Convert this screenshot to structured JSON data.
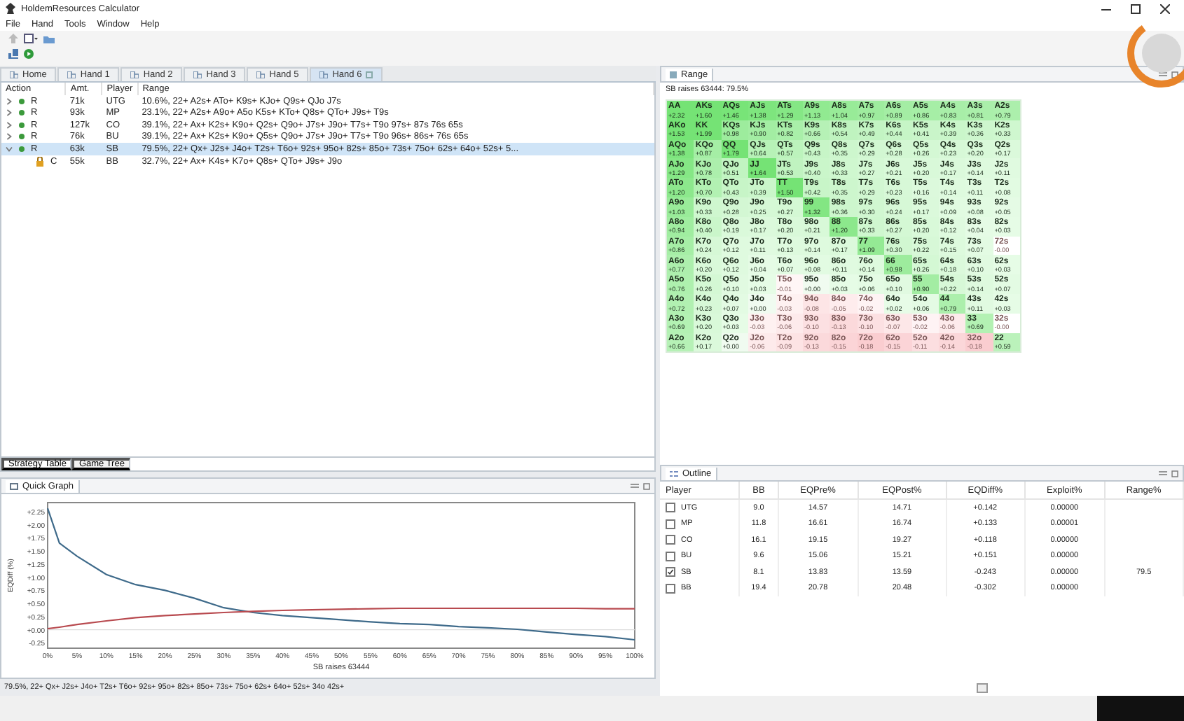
{
  "window": {
    "title": "HoldemResources Calculator"
  },
  "menu": [
    "File",
    "Hand",
    "Tools",
    "Window",
    "Help"
  ],
  "hand_tabs": [
    {
      "label": "Home",
      "selected": false
    },
    {
      "label": "Hand 1",
      "selected": false
    },
    {
      "label": "Hand 2",
      "selected": false
    },
    {
      "label": "Hand 3",
      "selected": false
    },
    {
      "label": "Hand 5",
      "selected": false
    },
    {
      "label": "Hand 6",
      "selected": true
    }
  ],
  "action_table": {
    "columns": [
      "Action",
      "Amt.",
      "Player",
      "Range"
    ],
    "rows": [
      {
        "kind": "dot",
        "expanded": false,
        "selected": false,
        "action": "R",
        "amt": "71k",
        "player": "UTG",
        "range": "10.6%, 22+ A2s+ ATo+ K9s+ KJo+ Q9s+ QJo J7s"
      },
      {
        "kind": "dot",
        "expanded": false,
        "selected": false,
        "action": "R",
        "amt": "93k",
        "player": "MP",
        "range": "23.1%, 22+ A2s+ A9o+ A5o K5s+ KTo+ Q8s+ QTo+ J9s+ T9s"
      },
      {
        "kind": "dot",
        "expanded": false,
        "selected": false,
        "action": "R",
        "amt": "127k",
        "player": "CO",
        "range": "39.1%, 22+ Ax+ K2s+ K9o+ Q2s+ Q9o+ J7s+ J9o+ T7s+ T9o 97s+ 87s 76s 65s"
      },
      {
        "kind": "dot",
        "expanded": false,
        "selected": false,
        "action": "R",
        "amt": "76k",
        "player": "BU",
        "range": "39.1%, 22+ Ax+ K2s+ K9o+ Q5s+ Q9o+ J7s+ J9o+ T7s+ T9o 96s+ 86s+ 76s 65s"
      },
      {
        "kind": "dot",
        "expanded": true,
        "selected": true,
        "action": "R",
        "amt": "63k",
        "player": "SB",
        "range": "79.5%, 22+ Qx+ J2s+ J4o+ T2s+ T6o+ 92s+ 95o+ 82s+ 85o+ 73s+ 75o+ 62s+ 64o+ 52s+ 5...",
        "children": [
          {
            "kind": "lock",
            "selected": false,
            "action": "C",
            "amt": "55k",
            "player": "BB",
            "range": "32.7%, 22+ Ax+ K4s+ K7o+ Q8s+ QTo+ J9s+ J9o"
          }
        ]
      }
    ]
  },
  "bottom_tabs": [
    {
      "label": "Strategy Table",
      "selected": true
    },
    {
      "label": "Game Tree",
      "selected": false
    }
  ],
  "quick_graph": {
    "title": "Quick Graph",
    "chart_data": {
      "type": "line",
      "xlabel": "SB raises 63444",
      "ylabel": "EQDiff (%)",
      "x": [
        0,
        2,
        5,
        10,
        15,
        20,
        25,
        30,
        35,
        40,
        45,
        50,
        55,
        60,
        65,
        70,
        75,
        80,
        85,
        90,
        95,
        100
      ],
      "series": [
        {
          "color": "#3e6a8a",
          "values": [
            2.31,
            1.65,
            1.4,
            1.05,
            0.86,
            0.75,
            0.6,
            0.42,
            0.33,
            0.27,
            0.23,
            0.19,
            0.15,
            0.12,
            0.1,
            0.06,
            0.04,
            0.01,
            -0.04,
            -0.09,
            -0.13,
            -0.19
          ]
        },
        {
          "color": "#b84a4f",
          "values": [
            0.02,
            0.05,
            0.1,
            0.17,
            0.23,
            0.27,
            0.3,
            0.33,
            0.35,
            0.37,
            0.38,
            0.39,
            0.4,
            0.41,
            0.41,
            0.41,
            0.41,
            0.41,
            0.41,
            0.41,
            0.4,
            0.4
          ]
        }
      ],
      "xlim": [
        0,
        100
      ],
      "ylim": [
        -0.35,
        2.42
      ],
      "xticks": [
        {
          "value": 0,
          "label": "0%"
        },
        {
          "value": 5,
          "label": "5%"
        },
        {
          "value": 10,
          "label": "10%"
        },
        {
          "value": 15,
          "label": "15%"
        },
        {
          "value": 20,
          "label": "20%"
        },
        {
          "value": 25,
          "label": "25%"
        },
        {
          "value": 30,
          "label": "30%"
        },
        {
          "value": 35,
          "label": "35%"
        },
        {
          "value": 40,
          "label": "40%"
        },
        {
          "value": 45,
          "label": "45%"
        },
        {
          "value": 50,
          "label": "50%"
        },
        {
          "value": 55,
          "label": "55%"
        },
        {
          "value": 60,
          "label": "60%"
        },
        {
          "value": 65,
          "label": "65%"
        },
        {
          "value": 70,
          "label": "70%"
        },
        {
          "value": 75,
          "label": "75%"
        },
        {
          "value": 80,
          "label": "80%"
        },
        {
          "value": 85,
          "label": "85%"
        },
        {
          "value": 90,
          "label": "90%"
        },
        {
          "value": 95,
          "label": "95%"
        },
        {
          "value": 100,
          "label": "100%"
        }
      ],
      "yticks": [
        {
          "value": 2.25,
          "label": "+2.25"
        },
        {
          "value": 2,
          "label": "+2.00"
        },
        {
          "value": 1.75,
          "label": "+1.75"
        },
        {
          "value": 1.5,
          "label": "+1.50"
        },
        {
          "value": 1.25,
          "label": "+1.25"
        },
        {
          "value": 1,
          "label": "+1.00"
        },
        {
          "value": 0.75,
          "label": "+0.75"
        },
        {
          "value": 0.5,
          "label": "+0.50"
        },
        {
          "value": 0.25,
          "label": "+0.25"
        },
        {
          "value": 0,
          "label": "+0.00"
        },
        {
          "value": -0.25,
          "label": "-0.25"
        }
      ]
    }
  },
  "status_text": "79.5%, 22+ Qx+ J2s+ J4o+ T2s+ T6o+ 92s+ 95o+ 82s+ 85o+ 73s+ 75o+ 62s+ 64o+ 52s+ 34o 42s+",
  "range_panel": {
    "title": "Range",
    "caption": "SB raises 63444: 79.5%",
    "grid": [
      [
        {
          "hand": "AA",
          "ev": "+2.32",
          "in_range": true
        },
        {
          "hand": "AKs",
          "ev": "+1.60",
          "in_range": true
        },
        {
          "hand": "AQs",
          "ev": "+1.46",
          "in_range": true
        },
        {
          "hand": "AJs",
          "ev": "+1.38",
          "in_range": true
        },
        {
          "hand": "ATs",
          "ev": "+1.29",
          "in_range": true
        },
        {
          "hand": "A9s",
          "ev": "+1.13",
          "in_range": true
        },
        {
          "hand": "A8s",
          "ev": "+1.04",
          "in_range": true
        },
        {
          "hand": "A7s",
          "ev": "+0.97",
          "in_range": true
        },
        {
          "hand": "A6s",
          "ev": "+0.89",
          "in_range": true
        },
        {
          "hand": "A5s",
          "ev": "+0.86",
          "in_range": true
        },
        {
          "hand": "A4s",
          "ev": "+0.83",
          "in_range": true
        },
        {
          "hand": "A3s",
          "ev": "+0.81",
          "in_range": true
        },
        {
          "hand": "A2s",
          "ev": "+0.79",
          "in_range": true
        }
      ],
      [
        {
          "hand": "AKo",
          "ev": "+1.53",
          "in_range": true
        },
        {
          "hand": "KK",
          "ev": "+1.99",
          "in_range": true
        },
        {
          "hand": "KQs",
          "ev": "+0.98",
          "in_range": true
        },
        {
          "hand": "KJs",
          "ev": "+0.90",
          "in_range": true
        },
        {
          "hand": "KTs",
          "ev": "+0.82",
          "in_range": true
        },
        {
          "hand": "K9s",
          "ev": "+0.66",
          "in_range": true
        },
        {
          "hand": "K8s",
          "ev": "+0.54",
          "in_range": true
        },
        {
          "hand": "K7s",
          "ev": "+0.49",
          "in_range": true
        },
        {
          "hand": "K6s",
          "ev": "+0.44",
          "in_range": true
        },
        {
          "hand": "K5s",
          "ev": "+0.41",
          "in_range": true
        },
        {
          "hand": "K4s",
          "ev": "+0.39",
          "in_range": true
        },
        {
          "hand": "K3s",
          "ev": "+0.36",
          "in_range": true
        },
        {
          "hand": "K2s",
          "ev": "+0.33",
          "in_range": true
        }
      ],
      [
        {
          "hand": "AQo",
          "ev": "+1.38",
          "in_range": true
        },
        {
          "hand": "KQo",
          "ev": "+0.87",
          "in_range": true
        },
        {
          "hand": "QQ",
          "ev": "+1.79",
          "in_range": true
        },
        {
          "hand": "QJs",
          "ev": "+0.64",
          "in_range": true
        },
        {
          "hand": "QTs",
          "ev": "+0.57",
          "in_range": true
        },
        {
          "hand": "Q9s",
          "ev": "+0.43",
          "in_range": true
        },
        {
          "hand": "Q8s",
          "ev": "+0.35",
          "in_range": true
        },
        {
          "hand": "Q7s",
          "ev": "+0.29",
          "in_range": true
        },
        {
          "hand": "Q6s",
          "ev": "+0.28",
          "in_range": true
        },
        {
          "hand": "Q5s",
          "ev": "+0.26",
          "in_range": true
        },
        {
          "hand": "Q4s",
          "ev": "+0.23",
          "in_range": true
        },
        {
          "hand": "Q3s",
          "ev": "+0.20",
          "in_range": true
        },
        {
          "hand": "Q2s",
          "ev": "+0.17",
          "in_range": true
        }
      ],
      [
        {
          "hand": "AJo",
          "ev": "+1.29",
          "in_range": true
        },
        {
          "hand": "KJo",
          "ev": "+0.78",
          "in_range": true
        },
        {
          "hand": "QJo",
          "ev": "+0.51",
          "in_range": true
        },
        {
          "hand": "JJ",
          "ev": "+1.64",
          "in_range": true
        },
        {
          "hand": "JTs",
          "ev": "+0.53",
          "in_range": true
        },
        {
          "hand": "J9s",
          "ev": "+0.40",
          "in_range": true
        },
        {
          "hand": "J8s",
          "ev": "+0.33",
          "in_range": true
        },
        {
          "hand": "J7s",
          "ev": "+0.27",
          "in_range": true
        },
        {
          "hand": "J6s",
          "ev": "+0.21",
          "in_range": true
        },
        {
          "hand": "J5s",
          "ev": "+0.20",
          "in_range": true
        },
        {
          "hand": "J4s",
          "ev": "+0.17",
          "in_range": true
        },
        {
          "hand": "J3s",
          "ev": "+0.14",
          "in_range": true
        },
        {
          "hand": "J2s",
          "ev": "+0.11",
          "in_range": true
        }
      ],
      [
        {
          "hand": "ATo",
          "ev": "+1.20",
          "in_range": true
        },
        {
          "hand": "KTo",
          "ev": "+0.70",
          "in_range": true
        },
        {
          "hand": "QTo",
          "ev": "+0.43",
          "in_range": true
        },
        {
          "hand": "JTo",
          "ev": "+0.39",
          "in_range": true
        },
        {
          "hand": "TT",
          "ev": "+1.50",
          "in_range": true
        },
        {
          "hand": "T9s",
          "ev": "+0.42",
          "in_range": true
        },
        {
          "hand": "T8s",
          "ev": "+0.35",
          "in_range": true
        },
        {
          "hand": "T7s",
          "ev": "+0.29",
          "in_range": true
        },
        {
          "hand": "T6s",
          "ev": "+0.23",
          "in_range": true
        },
        {
          "hand": "T5s",
          "ev": "+0.16",
          "in_range": true
        },
        {
          "hand": "T4s",
          "ev": "+0.14",
          "in_range": true
        },
        {
          "hand": "T3s",
          "ev": "+0.11",
          "in_range": true
        },
        {
          "hand": "T2s",
          "ev": "+0.08",
          "in_range": true
        }
      ],
      [
        {
          "hand": "A9o",
          "ev": "+1.03",
          "in_range": true
        },
        {
          "hand": "K9o",
          "ev": "+0.33",
          "in_range": true
        },
        {
          "hand": "Q9o",
          "ev": "+0.28",
          "in_range": true
        },
        {
          "hand": "J9o",
          "ev": "+0.25",
          "in_range": true
        },
        {
          "hand": "T9o",
          "ev": "+0.27",
          "in_range": true
        },
        {
          "hand": "99",
          "ev": "+1.32",
          "in_range": true
        },
        {
          "hand": "98s",
          "ev": "+0.36",
          "in_range": true
        },
        {
          "hand": "97s",
          "ev": "+0.30",
          "in_range": true
        },
        {
          "hand": "96s",
          "ev": "+0.24",
          "in_range": true
        },
        {
          "hand": "95s",
          "ev": "+0.17",
          "in_range": true
        },
        {
          "hand": "94s",
          "ev": "+0.09",
          "in_range": true
        },
        {
          "hand": "93s",
          "ev": "+0.08",
          "in_range": true
        },
        {
          "hand": "92s",
          "ev": "+0.05",
          "in_range": true
        }
      ],
      [
        {
          "hand": "A8o",
          "ev": "+0.94",
          "in_range": true
        },
        {
          "hand": "K8o",
          "ev": "+0.40",
          "in_range": true
        },
        {
          "hand": "Q8o",
          "ev": "+0.19",
          "in_range": true
        },
        {
          "hand": "J8o",
          "ev": "+0.17",
          "in_range": true
        },
        {
          "hand": "T8o",
          "ev": "+0.20",
          "in_range": true
        },
        {
          "hand": "98o",
          "ev": "+0.21",
          "in_range": true
        },
        {
          "hand": "88",
          "ev": "+1.20",
          "in_range": true
        },
        {
          "hand": "87s",
          "ev": "+0.33",
          "in_range": true
        },
        {
          "hand": "86s",
          "ev": "+0.27",
          "in_range": true
        },
        {
          "hand": "85s",
          "ev": "+0.20",
          "in_range": true
        },
        {
          "hand": "84s",
          "ev": "+0.12",
          "in_range": true
        },
        {
          "hand": "83s",
          "ev": "+0.04",
          "in_range": true
        },
        {
          "hand": "82s",
          "ev": "+0.03",
          "in_range": true
        }
      ],
      [
        {
          "hand": "A7o",
          "ev": "+0.86",
          "in_range": true
        },
        {
          "hand": "K7o",
          "ev": "+0.24",
          "in_range": true
        },
        {
          "hand": "Q7o",
          "ev": "+0.12",
          "in_range": true
        },
        {
          "hand": "J7o",
          "ev": "+0.11",
          "in_range": true
        },
        {
          "hand": "T7o",
          "ev": "+0.13",
          "in_range": true
        },
        {
          "hand": "97o",
          "ev": "+0.14",
          "in_range": true
        },
        {
          "hand": "87o",
          "ev": "+0.17",
          "in_range": true
        },
        {
          "hand": "77",
          "ev": "+1.09",
          "in_range": true
        },
        {
          "hand": "76s",
          "ev": "+0.30",
          "in_range": true
        },
        {
          "hand": "75s",
          "ev": "+0.22",
          "in_range": true
        },
        {
          "hand": "74s",
          "ev": "+0.15",
          "in_range": true
        },
        {
          "hand": "73s",
          "ev": "+0.07",
          "in_range": true
        },
        {
          "hand": "72s",
          "ev": "-0.00",
          "in_range": false
        }
      ],
      [
        {
          "hand": "A6o",
          "ev": "+0.77",
          "in_range": true
        },
        {
          "hand": "K6o",
          "ev": "+0.20",
          "in_range": true
        },
        {
          "hand": "Q6o",
          "ev": "+0.12",
          "in_range": true
        },
        {
          "hand": "J6o",
          "ev": "+0.04",
          "in_range": true
        },
        {
          "hand": "T6o",
          "ev": "+0.07",
          "in_range": true
        },
        {
          "hand": "96o",
          "ev": "+0.08",
          "in_range": true
        },
        {
          "hand": "86o",
          "ev": "+0.11",
          "in_range": true
        },
        {
          "hand": "76o",
          "ev": "+0.14",
          "in_range": true
        },
        {
          "hand": "66",
          "ev": "+0.98",
          "in_range": true
        },
        {
          "hand": "65s",
          "ev": "+0.26",
          "in_range": true
        },
        {
          "hand": "64s",
          "ev": "+0.18",
          "in_range": true
        },
        {
          "hand": "63s",
          "ev": "+0.10",
          "in_range": true
        },
        {
          "hand": "62s",
          "ev": "+0.03",
          "in_range": true
        }
      ],
      [
        {
          "hand": "A5o",
          "ev": "+0.76",
          "in_range": true
        },
        {
          "hand": "K5o",
          "ev": "+0.26",
          "in_range": true
        },
        {
          "hand": "Q5o",
          "ev": "+0.10",
          "in_range": true
        },
        {
          "hand": "J5o",
          "ev": "+0.03",
          "in_range": true
        },
        {
          "hand": "T5o",
          "ev": "-0.01",
          "in_range": false
        },
        {
          "hand": "95o",
          "ev": "+0.00",
          "in_range": true
        },
        {
          "hand": "85o",
          "ev": "+0.03",
          "in_range": true
        },
        {
          "hand": "75o",
          "ev": "+0.06",
          "in_range": true
        },
        {
          "hand": "65o",
          "ev": "+0.10",
          "in_range": true
        },
        {
          "hand": "55",
          "ev": "+0.90",
          "in_range": true
        },
        {
          "hand": "54s",
          "ev": "+0.22",
          "in_range": true
        },
        {
          "hand": "53s",
          "ev": "+0.14",
          "in_range": true
        },
        {
          "hand": "52s",
          "ev": "+0.07",
          "in_range": true
        }
      ],
      [
        {
          "hand": "A4o",
          "ev": "+0.72",
          "in_range": true
        },
        {
          "hand": "K4o",
          "ev": "+0.23",
          "in_range": true
        },
        {
          "hand": "Q4o",
          "ev": "+0.07",
          "in_range": true
        },
        {
          "hand": "J4o",
          "ev": "+0.00",
          "in_range": true
        },
        {
          "hand": "T4o",
          "ev": "-0.03",
          "in_range": false
        },
        {
          "hand": "94o",
          "ev": "-0.08",
          "in_range": false
        },
        {
          "hand": "84o",
          "ev": "-0.05",
          "in_range": false
        },
        {
          "hand": "74o",
          "ev": "-0.02",
          "in_range": false
        },
        {
          "hand": "64o",
          "ev": "+0.02",
          "in_range": true
        },
        {
          "hand": "54o",
          "ev": "+0.06",
          "in_range": true
        },
        {
          "hand": "44",
          "ev": "+0.79",
          "in_range": true
        },
        {
          "hand": "43s",
          "ev": "+0.11",
          "in_range": true
        },
        {
          "hand": "42s",
          "ev": "+0.03",
          "in_range": true
        }
      ],
      [
        {
          "hand": "A3o",
          "ev": "+0.69",
          "in_range": true
        },
        {
          "hand": "K3o",
          "ev": "+0.20",
          "in_range": true
        },
        {
          "hand": "Q3o",
          "ev": "+0.03",
          "in_range": true
        },
        {
          "hand": "J3o",
          "ev": "-0.03",
          "in_range": false
        },
        {
          "hand": "T3o",
          "ev": "-0.06",
          "in_range": false
        },
        {
          "hand": "93o",
          "ev": "-0.10",
          "in_range": false
        },
        {
          "hand": "83o",
          "ev": "-0.13",
          "in_range": false
        },
        {
          "hand": "73o",
          "ev": "-0.10",
          "in_range": false
        },
        {
          "hand": "63o",
          "ev": "-0.07",
          "in_range": false
        },
        {
          "hand": "53o",
          "ev": "-0.02",
          "in_range": false
        },
        {
          "hand": "43o",
          "ev": "-0.06",
          "in_range": false
        },
        {
          "hand": "33",
          "ev": "+0.69",
          "in_range": true
        },
        {
          "hand": "32s",
          "ev": "-0.00",
          "in_range": false
        }
      ],
      [
        {
          "hand": "A2o",
          "ev": "+0.66",
          "in_range": true
        },
        {
          "hand": "K2o",
          "ev": "+0.17",
          "in_range": true
        },
        {
          "hand": "Q2o",
          "ev": "+0.00",
          "in_range": true
        },
        {
          "hand": "J2o",
          "ev": "-0.06",
          "in_range": false
        },
        {
          "hand": "T2o",
          "ev": "-0.09",
          "in_range": false
        },
        {
          "hand": "92o",
          "ev": "-0.13",
          "in_range": false
        },
        {
          "hand": "82o",
          "ev": "-0.15",
          "in_range": false
        },
        {
          "hand": "72o",
          "ev": "-0.18",
          "in_range": false
        },
        {
          "hand": "62o",
          "ev": "-0.15",
          "in_range": false
        },
        {
          "hand": "52o",
          "ev": "-0.11",
          "in_range": false
        },
        {
          "hand": "42o",
          "ev": "-0.14",
          "in_range": false
        },
        {
          "hand": "32o",
          "ev": "-0.18",
          "in_range": false
        },
        {
          "hand": "22",
          "ev": "+0.59",
          "in_range": true
        }
      ]
    ]
  },
  "outline": {
    "title": "Outline",
    "columns": [
      "Player",
      "BB",
      "EQPre%",
      "EQPost%",
      "EQDiff%",
      "Exploit%",
      "Range%"
    ],
    "rows": [
      {
        "player": "UTG",
        "checked": false,
        "bb": "9.0",
        "eqpre": "14.57",
        "eqpost": "14.71",
        "eqdiff": "+0.142",
        "exploit": "0.00000"
      },
      {
        "player": "MP",
        "checked": false,
        "bb": "11.8",
        "eqpre": "16.61",
        "eqpost": "16.74",
        "eqdiff": "+0.133",
        "exploit": "0.00001"
      },
      {
        "player": "CO",
        "checked": false,
        "bb": "16.1",
        "eqpre": "19.15",
        "eqpost": "19.27",
        "eqdiff": "+0.118",
        "exploit": "0.00000"
      },
      {
        "player": "BU",
        "checked": false,
        "bb": "9.6",
        "eqpre": "15.06",
        "eqpost": "15.21",
        "eqdiff": "+0.151",
        "exploit": "0.00000"
      },
      {
        "player": "SB",
        "checked": true,
        "bb": "8.1",
        "eqpre": "13.83",
        "eqpost": "13.59",
        "eqdiff": "-0.243",
        "exploit": "0.00000",
        "range": "79.5"
      },
      {
        "player": "BB",
        "checked": false,
        "bb": "19.4",
        "eqpre": "20.78",
        "eqpost": "20.48",
        "eqdiff": "-0.302",
        "exploit": "0.00000"
      }
    ]
  }
}
